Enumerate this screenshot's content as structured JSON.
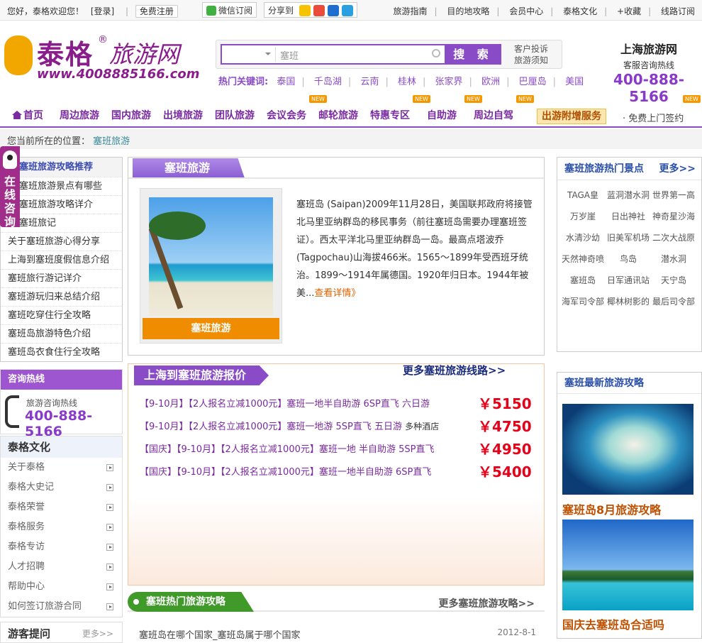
{
  "topbar": {
    "welcome": "您好，泰格欢迎您！",
    "login": "[登录]",
    "register": "免费注册",
    "wechat": "微信订阅",
    "share": "分享到",
    "links": [
      "旅游指南",
      "目的地攻略",
      "会员中心",
      "泰格文化",
      "+收藏",
      "线路订阅"
    ]
  },
  "logo": {
    "name": "泰格",
    "mark": "®",
    "name2": "旅游网",
    "url": "www.4008885166.com"
  },
  "search": {
    "placeholder": "塞班",
    "button": "搜 索",
    "side1": "客户投诉",
    "side2": "旅游须知"
  },
  "hot": {
    "label": "热门关键词:",
    "keywords": [
      "泰国",
      "千岛湖",
      "云南",
      "桂林",
      "张家界",
      "欧洲",
      "巴厘岛",
      "美国"
    ]
  },
  "hotline": {
    "title": "上海旅游网",
    "sub": "客服咨询热线",
    "phone": "400-888-5166"
  },
  "nav": {
    "items": [
      "首页",
      "周边旅游",
      "国内旅游",
      "出境旅游",
      "团队旅游",
      "会议会务",
      "邮轮旅游",
      "特惠专区",
      "自助游",
      "周边自驾"
    ],
    "new_badge": "NEW",
    "extra": "出游附增服务",
    "free": "· 免费上门签约"
  },
  "breadcrumb": {
    "prefix": "您当前所在的位置：",
    "current": "塞班旅游"
  },
  "left": {
    "guide_title": "塞班旅游攻略推荐",
    "guide_items": [
      "塞班旅游景点有哪些",
      "塞班旅游攻略详介",
      "塞班旅记",
      "关于塞班旅游心得分享",
      "上海到塞班度假信息介绍",
      "塞班旅行游记详介",
      "塞班游玩归来总结介绍",
      "塞班吃穿住行全攻略",
      "塞班岛旅游特色介绍",
      "塞班岛衣食住行全攻略"
    ],
    "qq": "在线咨询",
    "consult_title": "咨询热线",
    "consult_label": "旅游咨询热线",
    "consult_phone": "400-888-5166",
    "culture_title": "泰格文化",
    "culture_items": [
      "关于泰格",
      "泰格大史记",
      "泰格荣誉",
      "泰格服务",
      "泰格专访",
      "人才招聘",
      "帮助中心",
      "如何签订旅游合同"
    ],
    "ask_title": "游客提问",
    "ask_more": "更多>>"
  },
  "center": {
    "title": "塞班旅游",
    "photo_caption": "塞班旅游",
    "intro": "塞班岛 (Saipan)2009年11月28日，美国联邦政府将接管北马里亚纳群岛的移民事务（前往塞班岛需要办理塞班签证）。西太平洋北马里亚纳群岛一岛。最高点塔波乔(Tagpochau)山海拔466米。1565～1899年受西班牙统治。1899～1914年属德国。1920年归日本。1944年被美...",
    "intro_more": "查看详情》",
    "price_title": "上海到塞班旅游报价",
    "price_more": "更多塞班旅游线路>>",
    "routes": [
      {
        "text": "【9-10月】【2人报名立减1000元】塞班一地半自助游 6SP直飞 六日游",
        "extra": "",
        "price": "￥5150"
      },
      {
        "text": "【9-10月】【2人报名立减1000元】塞班一地游 5SP直飞 五日游",
        "extra": "多种酒店",
        "price": "￥4750"
      },
      {
        "text": "【国庆】【9-10月】【2人报名立减1000元】塞班一地 半自助游 5SP直飞",
        "extra": "",
        "price": "￥4950"
      },
      {
        "text": "【国庆】【9-10月】【2人报名立减1000元】塞班一地半自助游 6SP直飞",
        "extra": "",
        "price": "￥5400"
      }
    ],
    "hot_title": "塞班热门旅游攻略",
    "hot_more": "更多塞班旅游攻略>>",
    "hot_item": "塞班岛在哪个国家_塞班岛属于哪个国家",
    "hot_date": "2012-8-1"
  },
  "right": {
    "spots_title": "塞班旅游热门景点",
    "spots_more": "更多>>",
    "spots": [
      "TAGA皇",
      "蓝洞潜水洞",
      "世界第一高",
      "万岁崖",
      "日出神社",
      "神奇星沙海",
      "水清沙幼",
      "旧美军机场",
      "二次大战原",
      "天然神奇喷",
      "鸟岛",
      "潜水洞",
      "塞班岛",
      "日军通讯站",
      "天宁岛",
      "海军司令部",
      "椰林树影的",
      "最后司令部"
    ],
    "news_title": "塞班最新旅游攻略",
    "news1": "塞班岛8月旅游攻略",
    "news2": "国庆去塞班岛合适吗"
  }
}
